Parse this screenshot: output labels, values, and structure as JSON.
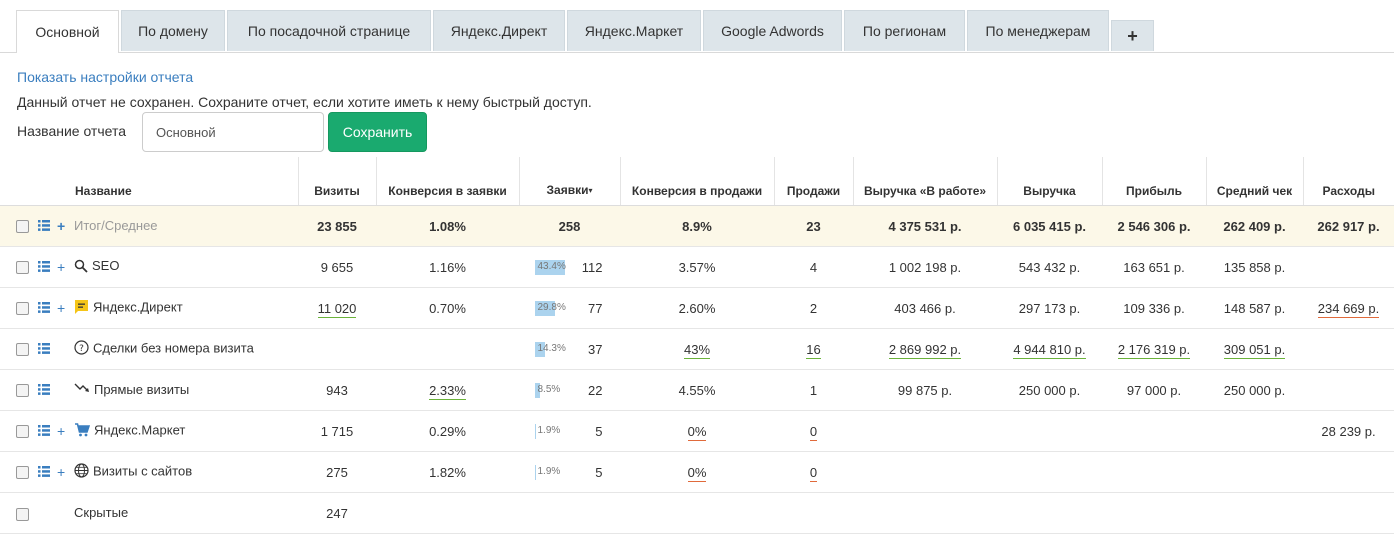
{
  "tabs": [
    {
      "label": "Основной",
      "active": true
    },
    {
      "label": "По домену"
    },
    {
      "label": "По посадочной странице"
    },
    {
      "label": "Яндекс.Директ"
    },
    {
      "label": "Яндекс.Маркет"
    },
    {
      "label": "Google Adwords"
    },
    {
      "label": "По регионам"
    },
    {
      "label": "По менеджерам"
    },
    {
      "label": "+"
    }
  ],
  "settings_link": "Показать настройки отчета",
  "notice": "Данный отчет не сохранен. Сохраните отчет, если хотите иметь к нему быстрый доступ.",
  "report_name_label": "Название отчета",
  "report_name_value": "Основной",
  "save_label": "Сохранить",
  "columns": [
    "Название",
    "Визиты",
    "Конверсия в заявки",
    "Заявки",
    "Конверсия в продажи",
    "Продажи",
    "Выручка «В работе»",
    "Выручка",
    "Прибыль",
    "Средний чек",
    "Расходы"
  ],
  "sort_indicator": "▾",
  "colors": {
    "accent": "#3a7ebf",
    "save": "#1aaa6f",
    "bar": "#abd3ee",
    "total_bg": "#fcf8e8",
    "underline_good": "#6bb33a",
    "underline_bad": "#e06a3b"
  },
  "rows": [
    {
      "name": "Итог/Среднее",
      "total": true,
      "icon": "",
      "expand": true,
      "visits": "23 855",
      "conv_leads": "1.08%",
      "leads": "258",
      "conv_sales": "8.9%",
      "sales": "23",
      "rev_work": "4 375 531 р.",
      "revenue": "6 035 415 р.",
      "profit": "2 546 306 р.",
      "avg_check": "262 409 р.",
      "expenses": "262 917 р."
    },
    {
      "name": "SEO",
      "icon": "search-icon",
      "expand": true,
      "visits": "9 655",
      "conv_leads": "1.16%",
      "leads_pct": 43.4,
      "leads_pct_label": "43.4%",
      "leads": "112",
      "conv_sales": "3.57%",
      "sales": "4",
      "rev_work": "1 002 198 р.",
      "revenue": "543 432 р.",
      "profit": "163 651 р.",
      "avg_check": "135 858 р.",
      "expenses": ""
    },
    {
      "name": "Яндекс.Директ",
      "icon": "yandex-direct-icon",
      "expand": true,
      "visits": "11 020",
      "visits_ul": "g",
      "conv_leads": "0.70%",
      "leads_pct": 29.8,
      "leads_pct_label": "29.8%",
      "leads": "77",
      "conv_sales": "2.60%",
      "sales": "2",
      "rev_work": "403 466 р.",
      "revenue": "297 173 р.",
      "profit": "109 336 р.",
      "avg_check": "148 587 р.",
      "expenses": "234 669 р.",
      "expenses_ul": "r"
    },
    {
      "name": "Сделки без номера визита",
      "icon": "question-icon",
      "expand": false,
      "visits": "",
      "conv_leads": "",
      "leads_pct": 14.3,
      "leads_pct_label": "14.3%",
      "leads": "37",
      "conv_sales": "43%",
      "conv_sales_ul": "g",
      "sales": "16",
      "sales_ul": "g",
      "rev_work": "2 869 992 р.",
      "rev_work_ul": "g",
      "revenue": "4 944 810 р.",
      "revenue_ul": "g",
      "profit": "2 176 319 р.",
      "profit_ul": "g",
      "avg_check": "309 051 р.",
      "avg_check_ul": "g",
      "expenses": ""
    },
    {
      "name": "Прямые визиты",
      "icon": "direct-visit-icon",
      "expand": false,
      "visits": "943",
      "conv_leads": "2.33%",
      "conv_leads_ul": "g",
      "leads_pct": 8.5,
      "leads_pct_label": "8.5%",
      "leads": "22",
      "conv_sales": "4.55%",
      "sales": "1",
      "rev_work": "99 875 р.",
      "revenue": "250 000 р.",
      "profit": "97 000 р.",
      "avg_check": "250 000 р.",
      "expenses": ""
    },
    {
      "name": "Яндекс.Маркет",
      "icon": "cart-icon",
      "expand": true,
      "visits": "1 715",
      "conv_leads": "0.29%",
      "leads_pct": 1.9,
      "leads_pct_label": "1.9%",
      "leads": "5",
      "conv_sales": "0%",
      "conv_sales_ul": "r",
      "sales": "0",
      "sales_ul": "r",
      "rev_work": "",
      "revenue": "",
      "profit": "",
      "avg_check": "",
      "expenses": "28 239 р."
    },
    {
      "name": "Визиты с сайтов",
      "icon": "globe-icon",
      "expand": true,
      "visits": "275",
      "conv_leads": "1.82%",
      "leads_pct": 1.9,
      "leads_pct_label": "1.9%",
      "leads": "5",
      "conv_sales": "0%",
      "conv_sales_ul": "r",
      "sales": "0",
      "sales_ul": "r",
      "rev_work": "",
      "revenue": "",
      "profit": "",
      "avg_check": "",
      "expenses": ""
    },
    {
      "name": "Скрытые",
      "icon": "",
      "expand": false,
      "hidden_row": true,
      "visits": "247",
      "conv_leads": "",
      "leads": "",
      "conv_sales": "",
      "sales": "",
      "rev_work": "",
      "revenue": "",
      "profit": "",
      "avg_check": "",
      "expenses": ""
    }
  ]
}
